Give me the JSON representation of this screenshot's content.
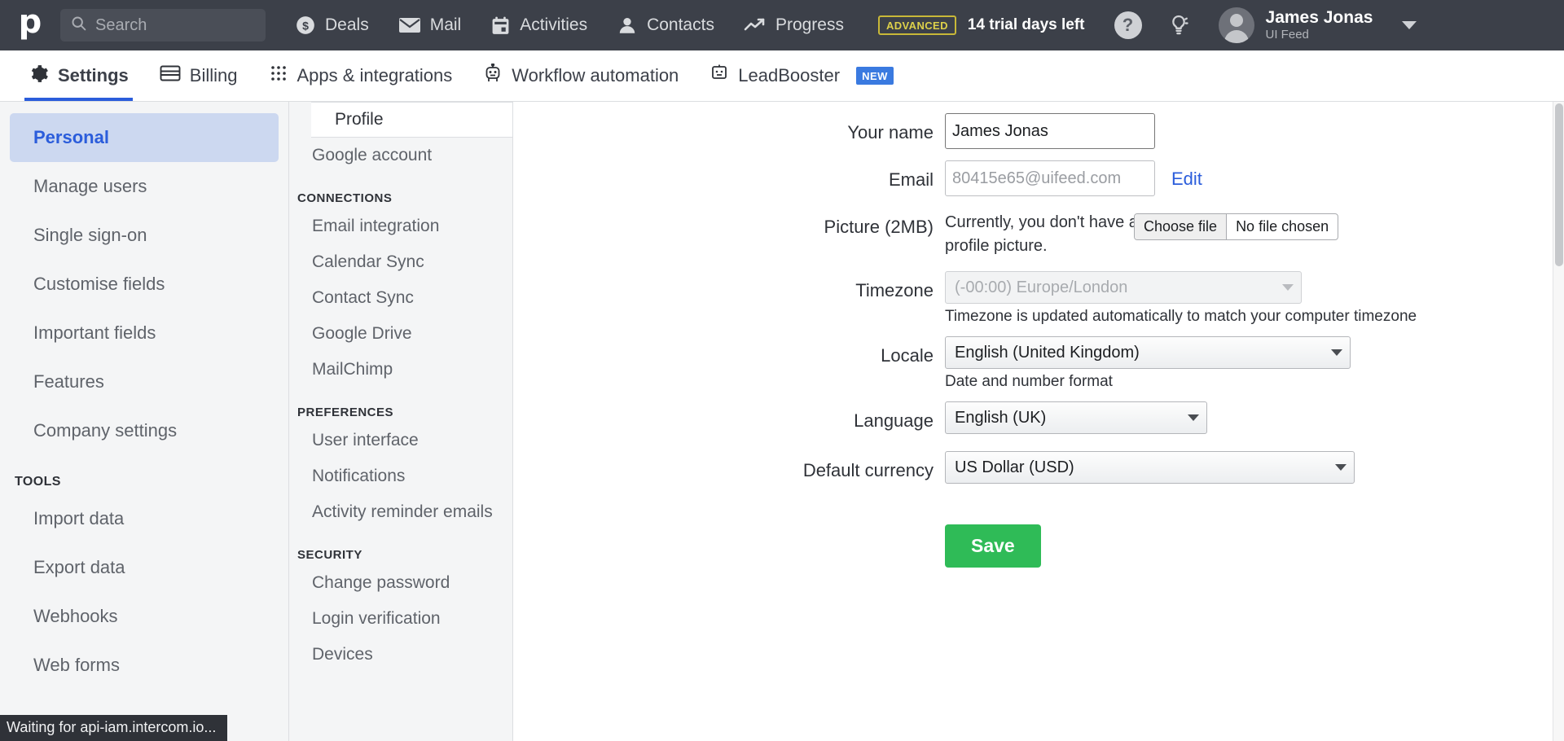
{
  "topnav": {
    "logo_icon": "pipedrive-logo-icon",
    "search": {
      "placeholder": "Search",
      "icon": "search-icon"
    },
    "items": [
      {
        "label": "Deals",
        "icon": "dollar-circle-icon"
      },
      {
        "label": "Mail",
        "icon": "envelope-icon"
      },
      {
        "label": "Activities",
        "icon": "calendar-icon"
      },
      {
        "label": "Contacts",
        "icon": "person-icon"
      },
      {
        "label": "Progress",
        "icon": "trend-up-icon"
      }
    ],
    "plan_badge": "ADVANCED",
    "trial_text": "14 trial days left",
    "help_icon": "question-mark-icon",
    "help_label": "?",
    "tips_icon": "lightbulb-icon",
    "user": {
      "name": "James Jonas",
      "company": "UI Feed",
      "avatar_icon": "avatar-icon",
      "caret_icon": "chevron-down-icon"
    },
    "colors": {
      "bar_bg": "#3c4049",
      "badge_border": "#c8b838",
      "badge_text": "#ddd04a"
    }
  },
  "subnav": {
    "items": [
      {
        "label": "Settings",
        "icon": "gear-icon",
        "active": true,
        "badge": ""
      },
      {
        "label": "Billing",
        "icon": "card-icon",
        "active": false,
        "badge": ""
      },
      {
        "label": "Apps & integrations",
        "icon": "grid-dots-icon",
        "active": false,
        "badge": ""
      },
      {
        "label": "Workflow automation",
        "icon": "robot-icon",
        "active": false,
        "badge": ""
      },
      {
        "label": "LeadBooster",
        "icon": "chatbot-icon",
        "active": false,
        "badge": "NEW"
      }
    ],
    "accent": "#2b5ddb",
    "badge_color": "#3a7ae0"
  },
  "sidebar": {
    "items": [
      {
        "label": "Personal",
        "active": true
      },
      {
        "label": "Manage users",
        "active": false
      },
      {
        "label": "Single sign-on",
        "active": false
      },
      {
        "label": "Customise fields",
        "active": false
      },
      {
        "label": "Important fields",
        "active": false
      },
      {
        "label": "Features",
        "active": false
      },
      {
        "label": "Company settings",
        "active": false
      }
    ],
    "tools_header": "TOOLS",
    "tools": [
      {
        "label": "Import data"
      },
      {
        "label": "Export data"
      },
      {
        "label": "Webhooks"
      },
      {
        "label": "Web forms"
      }
    ]
  },
  "subsidebar": {
    "top_items": [
      {
        "label": "Profile",
        "active": true
      },
      {
        "label": "Google account",
        "active": false
      }
    ],
    "connections_header": "CONNECTIONS",
    "connections": [
      {
        "label": "Email integration"
      },
      {
        "label": "Calendar Sync"
      },
      {
        "label": "Contact Sync"
      },
      {
        "label": "Google Drive"
      },
      {
        "label": "MailChimp"
      }
    ],
    "preferences_header": "PREFERENCES",
    "preferences": [
      {
        "label": "User interface"
      },
      {
        "label": "Notifications"
      },
      {
        "label": "Activity reminder emails"
      }
    ],
    "security_header": "SECURITY",
    "security": [
      {
        "label": "Change password"
      },
      {
        "label": "Login verification"
      },
      {
        "label": "Devices"
      }
    ]
  },
  "form": {
    "name": {
      "label": "Your name",
      "value": "James Jonas"
    },
    "email": {
      "label": "Email",
      "value": "80415e65@uifeed.com",
      "edit_label": "Edit"
    },
    "picture": {
      "label": "Picture (2MB)",
      "help": "Currently, you don't have a profile picture.",
      "choose_label": "Choose file",
      "file_label": "No file chosen"
    },
    "timezone": {
      "label": "Timezone",
      "value": "(-00:00) Europe/London",
      "help": "Timezone is updated automatically to match your computer timezone"
    },
    "locale": {
      "label": "Locale",
      "value": "English (United Kingdom)",
      "help": "Date and number format"
    },
    "language": {
      "label": "Language",
      "value": "English (UK)"
    },
    "currency": {
      "label": "Default currency",
      "value": "US Dollar (USD)"
    },
    "save_label": "Save",
    "save_color": "#2fbb57"
  },
  "statusbar": {
    "text": "Waiting for api-iam.intercom.io..."
  }
}
